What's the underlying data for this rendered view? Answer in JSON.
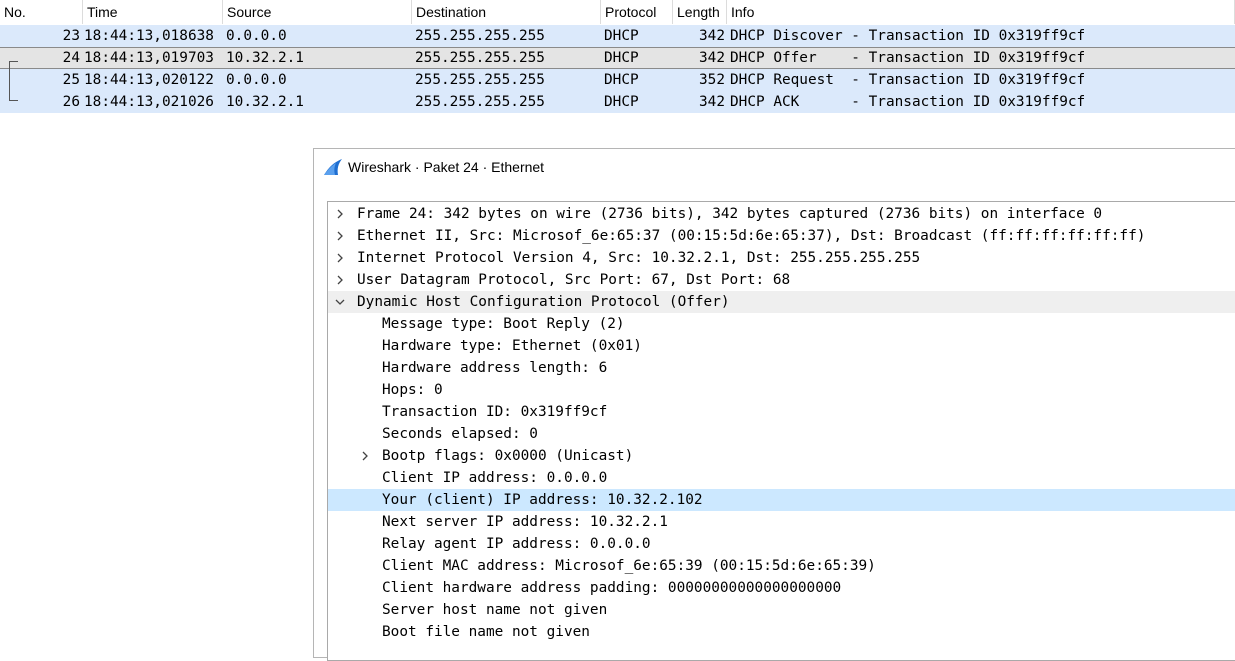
{
  "packet_list": {
    "columns": [
      "No.",
      "Time",
      "Source",
      "Destination",
      "Protocol",
      "Length",
      "Info"
    ],
    "rows": [
      {
        "no": "23",
        "time": "18:44:13,018638",
        "source": "0.0.0.0",
        "destination": "255.255.255.255",
        "protocol": "DHCP",
        "length": "342",
        "info": "DHCP Discover - Transaction ID 0x319ff9cf"
      },
      {
        "no": "24",
        "time": "18:44:13,019703",
        "source": "10.32.2.1",
        "destination": "255.255.255.255",
        "protocol": "DHCP",
        "length": "342",
        "info": "DHCP Offer    - Transaction ID 0x319ff9cf"
      },
      {
        "no": "25",
        "time": "18:44:13,020122",
        "source": "0.0.0.0",
        "destination": "255.255.255.255",
        "protocol": "DHCP",
        "length": "352",
        "info": "DHCP Request  - Transaction ID 0x319ff9cf"
      },
      {
        "no": "26",
        "time": "18:44:13,021026",
        "source": "10.32.2.1",
        "destination": "255.255.255.255",
        "protocol": "DHCP",
        "length": "342",
        "info": "DHCP ACK      - Transaction ID 0x319ff9cf"
      }
    ]
  },
  "detail_window": {
    "title": "Wireshark · Paket 24 · Ethernet",
    "tree": [
      {
        "label": "Frame 24: 342 bytes on wire (2736 bits), 342 bytes captured (2736 bits) on interface 0",
        "indent": 0,
        "expander": "collapsed"
      },
      {
        "label": "Ethernet II, Src: Microsof_6e:65:37 (00:15:5d:6e:65:37), Dst: Broadcast (ff:ff:ff:ff:ff:ff)",
        "indent": 0,
        "expander": "collapsed"
      },
      {
        "label": "Internet Protocol Version 4, Src: 10.32.2.1, Dst: 255.255.255.255",
        "indent": 0,
        "expander": "collapsed"
      },
      {
        "label": "User Datagram Protocol, Src Port: 67, Dst Port: 68",
        "indent": 0,
        "expander": "collapsed"
      },
      {
        "label": "Dynamic Host Configuration Protocol (Offer)",
        "indent": 0,
        "expander": "expanded"
      },
      {
        "label": "Message type: Boot Reply (2)",
        "indent": 1,
        "expander": "none"
      },
      {
        "label": "Hardware type: Ethernet (0x01)",
        "indent": 1,
        "expander": "none"
      },
      {
        "label": "Hardware address length: 6",
        "indent": 1,
        "expander": "none"
      },
      {
        "label": "Hops: 0",
        "indent": 1,
        "expander": "none"
      },
      {
        "label": "Transaction ID: 0x319ff9cf",
        "indent": 1,
        "expander": "none"
      },
      {
        "label": "Seconds elapsed: 0",
        "indent": 1,
        "expander": "none"
      },
      {
        "label": "Bootp flags: 0x0000 (Unicast)",
        "indent": 1,
        "expander": "collapsed"
      },
      {
        "label": "Client IP address: 0.0.0.0",
        "indent": 1,
        "expander": "none"
      },
      {
        "label": "Your (client) IP address: 10.32.2.102",
        "indent": 1,
        "expander": "none",
        "highlighted": true
      },
      {
        "label": "Next server IP address: 10.32.2.1",
        "indent": 1,
        "expander": "none"
      },
      {
        "label": "Relay agent IP address: 0.0.0.0",
        "indent": 1,
        "expander": "none"
      },
      {
        "label": "Client MAC address: Microsof_6e:65:39 (00:15:5d:6e:65:39)",
        "indent": 1,
        "expander": "none"
      },
      {
        "label": "Client hardware address padding: 00000000000000000000",
        "indent": 1,
        "expander": "none"
      },
      {
        "label": "Server host name not given",
        "indent": 1,
        "expander": "none"
      },
      {
        "label": "Boot file name not given",
        "indent": 1,
        "expander": "none"
      }
    ]
  },
  "colors": {
    "row_bg": "#dbe9fb",
    "selected_row_bg": "#e4e4e4",
    "tree_highlight": "#cce8ff",
    "tree_shaded": "#efefef",
    "icon_blue": "#1f6fd1"
  },
  "icons": {
    "app": "wireshark-fin-icon",
    "collapsed": "chevron-right-icon",
    "expanded": "chevron-down-icon"
  }
}
